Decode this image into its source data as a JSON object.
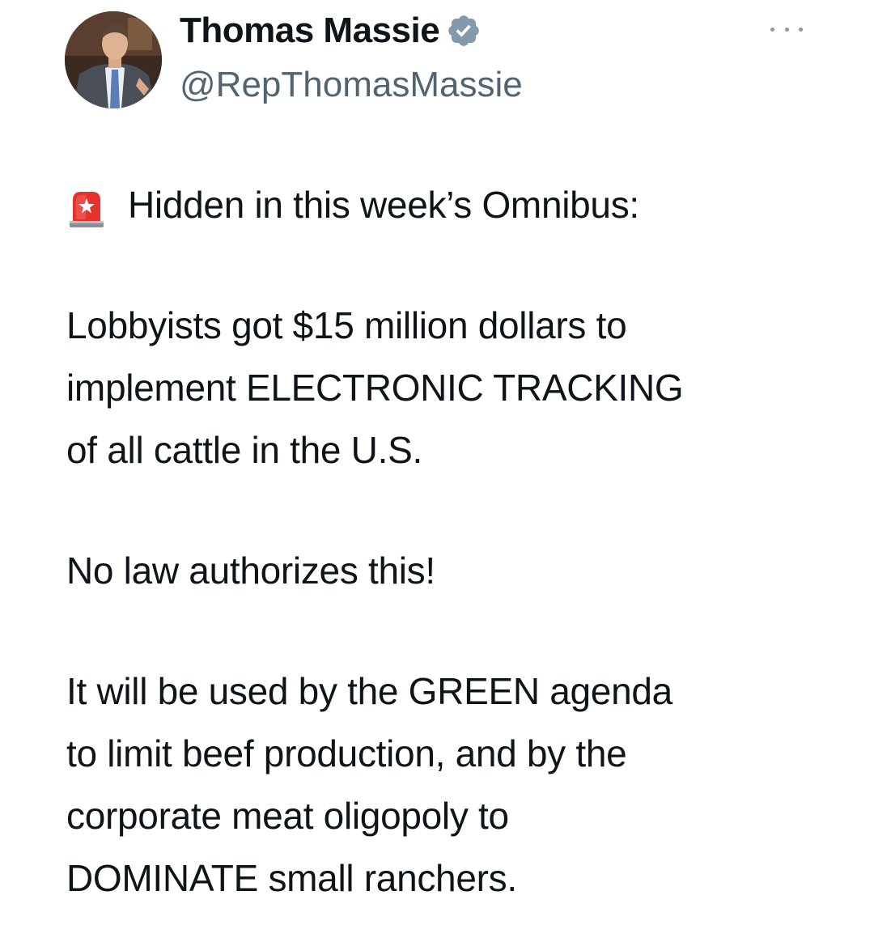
{
  "author": {
    "display_name": "Thomas Massie",
    "handle": "@RepThomasMassie",
    "verified": true
  },
  "tweet": {
    "emoji_icon": "police-car-light",
    "first_line": "Hidden in this week’s Omnibus:",
    "paragraph_2": [
      "Lobbyists got $15 million dollars to",
      "implement ELECTRONIC TRACKING",
      "of all cattle in the U.S."
    ],
    "paragraph_3": [
      "No law authorizes this!"
    ],
    "paragraph_4": [
      "It will be used by the GREEN agenda",
      "to limit beef production, and by the",
      "corporate meat oligopoly to",
      "DOMINATE small ranchers."
    ]
  },
  "colors": {
    "text": "#0f1419",
    "secondary": "#536471",
    "verified_badge": "#829aab"
  }
}
